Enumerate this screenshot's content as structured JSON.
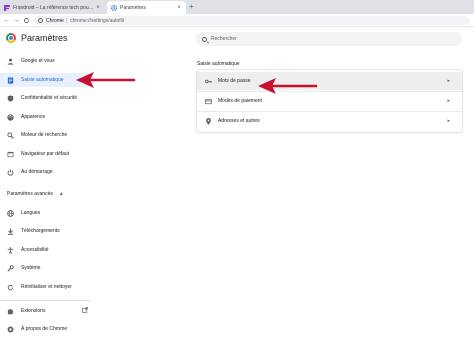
{
  "tabs": [
    {
      "title": "Frandroid – La référence tech pour…",
      "active": false
    },
    {
      "title": "Paramètres",
      "active": true
    }
  ],
  "new_tab_symbol": "+",
  "close_symbol": "×",
  "toolbar": {
    "back": "←",
    "forward": "→",
    "reload": "C",
    "omnibox_label": "Chrome",
    "omnibox_sep": "|",
    "url": "chrome://settings/autofill"
  },
  "header": {
    "title": "Paramètres",
    "search_placeholder": "Rechercher"
  },
  "sidebar": {
    "items": [
      {
        "label": "Google et vous",
        "icon": "person-icon"
      },
      {
        "label": "Saisie automatique",
        "icon": "autofill-icon",
        "selected": true
      },
      {
        "label": "Confidentialité et sécurité",
        "icon": "shield-icon"
      },
      {
        "label": "Apparence",
        "icon": "palette-icon"
      },
      {
        "label": "Moteur de recherche",
        "icon": "search-icon"
      },
      {
        "label": "Navigateur par défaut",
        "icon": "browser-icon"
      },
      {
        "label": "Au démarrage",
        "icon": "power-icon"
      }
    ],
    "advanced_label": "Paramètres avancés",
    "advanced_caret": "▲",
    "advanced_items": [
      {
        "label": "Langues",
        "icon": "globe-icon"
      },
      {
        "label": "Téléchargements",
        "icon": "download-icon"
      },
      {
        "label": "Accessibilité",
        "icon": "accessibility-icon"
      },
      {
        "label": "Système",
        "icon": "wrench-icon"
      },
      {
        "label": "Réinitialiser et nettoyer",
        "icon": "reset-icon"
      }
    ],
    "extensions_label": "Extensions",
    "about_label": "À propos de Chrome"
  },
  "main": {
    "section_title": "Saisie automatique",
    "rows": [
      {
        "label": "Mots de passe",
        "icon": "key-icon",
        "highlighted": true
      },
      {
        "label": "Modes de paiement",
        "icon": "credit-card-icon"
      },
      {
        "label": "Adresses et autres",
        "icon": "location-pin-icon"
      }
    ],
    "chevron": "▸"
  },
  "colors": {
    "accent": "#1967d2",
    "selected_bg": "#e8f0fe",
    "annotation_arrow": "#c8102e"
  }
}
